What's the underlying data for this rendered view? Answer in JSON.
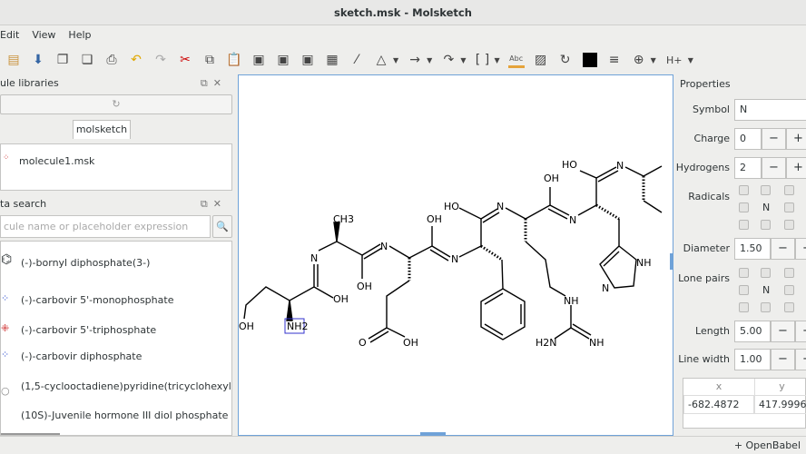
{
  "window": {
    "title": "sketch.msk - Molsketch"
  },
  "menu": [
    "Edit",
    "View",
    "Help"
  ],
  "toolbar": {
    "hydrogen_label": "H+",
    "text_label": "Abc"
  },
  "libraries": {
    "title": "ule libraries",
    "tab": "molsketch",
    "items": [
      "molecule1.msk"
    ]
  },
  "search": {
    "title": "ta search",
    "placeholder": "cule name or placeholder expression",
    "results": [
      "(-)-bornyl diphosphate(3-)",
      "(-)-carbovir 5'-monophosphate",
      "(-)-carbovir 5'-triphosphate",
      "(-)-carbovir diphosphate",
      "(1,5-cyclooctadiene)pyridine(tricyclohexylpho",
      "(10S)-Juvenile hormone III diol phosphate"
    ]
  },
  "properties": {
    "title": "Properties",
    "symbol_label": "Symbol",
    "symbol": "N",
    "charge_label": "Charge",
    "charge": "0",
    "hydrogens_label": "Hydrogens",
    "hydrogens": "2",
    "radicals_label": "Radicals",
    "diameter_label": "Diameter",
    "diameter": "1.50",
    "lonepairs_label": "Lone pairs",
    "center_atom": "N",
    "length_label": "Length",
    "length": "5.00",
    "linewidth_label": "Line width",
    "linewidth": "1.00",
    "minus": "−",
    "plus": "+",
    "coords": {
      "x_header": "x",
      "y_header": "y",
      "x": "-682.4872",
      "y": "417.9996"
    }
  },
  "status": {
    "openbabel": "+ OpenBabel"
  },
  "atoms": [
    "OH",
    "NH2",
    "N",
    "OH",
    "CH3",
    "OH",
    "N",
    "O",
    "OH",
    "OH",
    "N",
    "HO",
    "N",
    "NH",
    "H2N",
    "NH",
    "OH",
    "N",
    "HO",
    "N",
    "NH",
    "N"
  ],
  "colors": {
    "accent": "#6fa2d8",
    "selection": "#3333cc"
  }
}
